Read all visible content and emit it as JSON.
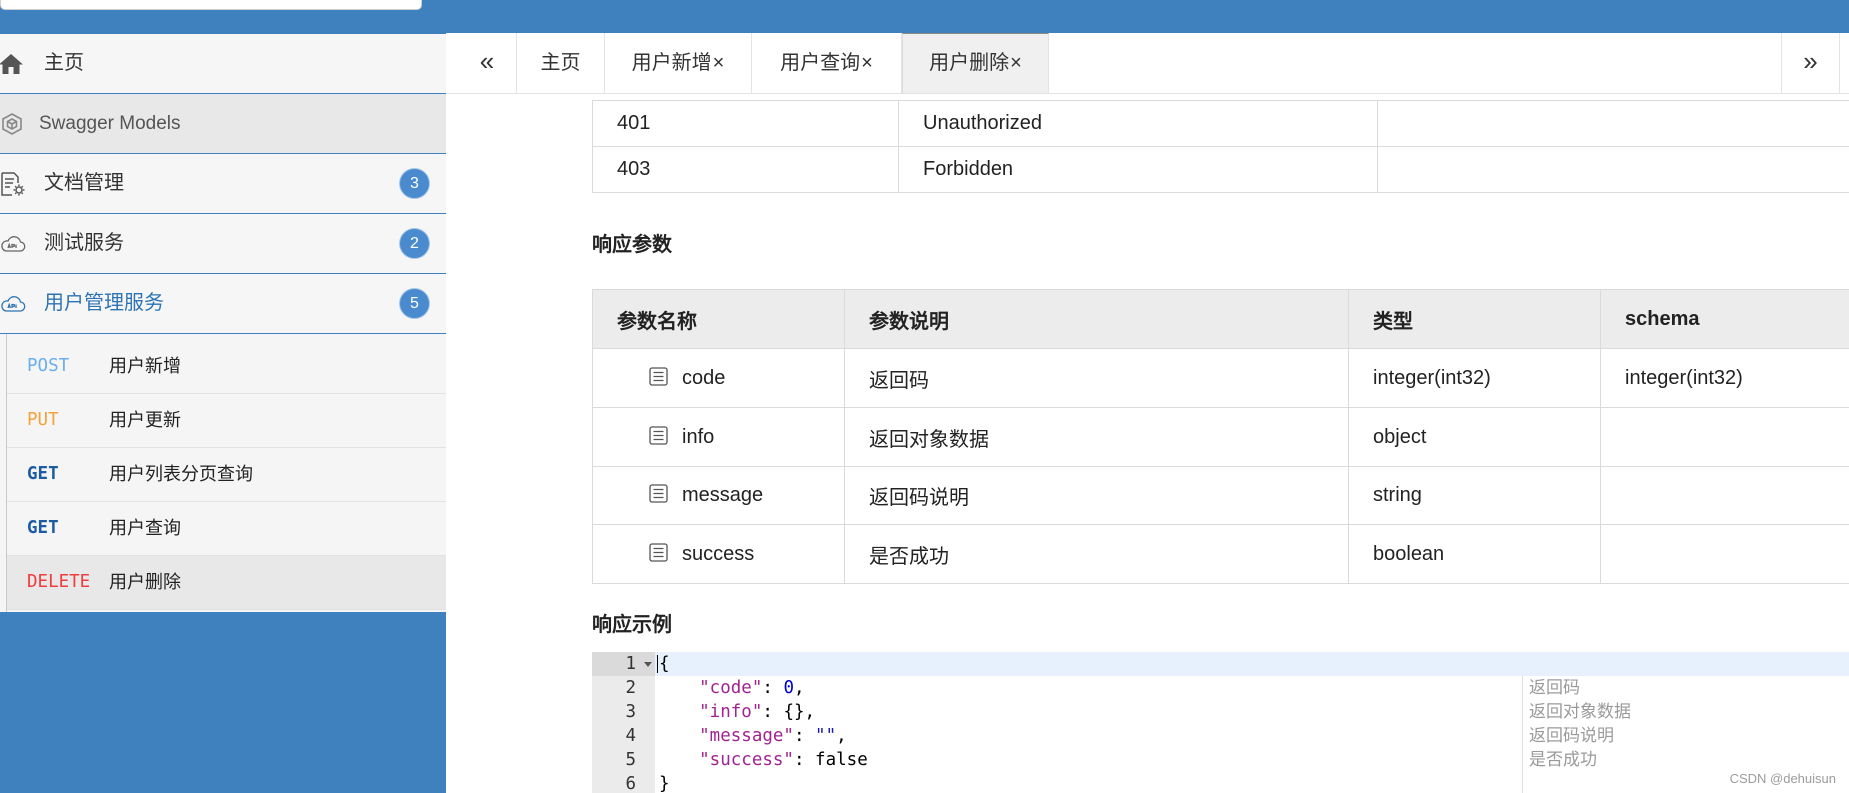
{
  "colors": {
    "brand_blue": "#3f80be",
    "badge_blue": "#4a8bcf",
    "active_nav_text": "#2e74b5",
    "method_post": "#6aaef0",
    "method_put": "#f4a13a",
    "method_get": "#1d5ca3",
    "method_delete": "#f03c3c"
  },
  "sidebar": {
    "items": [
      {
        "label": "主页",
        "icon": "home-icon"
      },
      {
        "label": "Swagger Models",
        "icon": "swagger-models-icon"
      },
      {
        "label": "文档管理",
        "icon": "document-settings-icon",
        "badge": "3"
      },
      {
        "label": "测试服务",
        "icon": "api-cloud-icon",
        "badge": "2"
      },
      {
        "label": "用户管理服务",
        "icon": "api-cloud-icon",
        "badge": "5",
        "active": true
      }
    ],
    "endpoints": [
      {
        "method": "POST",
        "label": "用户新增"
      },
      {
        "method": "PUT",
        "label": "用户更新"
      },
      {
        "method": "GET",
        "label": "用户列表分页查询"
      },
      {
        "method": "GET",
        "label": "用户查询"
      },
      {
        "method": "DELETE",
        "label": "用户删除",
        "selected": true
      }
    ]
  },
  "tabs": {
    "prev_label": "«",
    "next_label": "»",
    "items": [
      {
        "label": "主页"
      },
      {
        "label": "用户新增",
        "close": "×"
      },
      {
        "label": "用户查询",
        "close": "×"
      },
      {
        "label": "用户删除",
        "close": "×",
        "active": true
      }
    ]
  },
  "status_codes": {
    "rows": [
      {
        "code": "401",
        "description": "Unauthorized"
      },
      {
        "code": "403",
        "description": "Forbidden"
      }
    ]
  },
  "response_params": {
    "heading": "响应参数",
    "columns": [
      "参数名称",
      "参数说明",
      "类型",
      "schema"
    ],
    "rows": [
      {
        "name": "code",
        "description": "返回码",
        "type": "integer(int32)",
        "schema": "integer(int32)"
      },
      {
        "name": "info",
        "description": "返回对象数据",
        "type": "object"
      },
      {
        "name": "message",
        "description": "返回码说明",
        "type": "string"
      },
      {
        "name": "success",
        "description": "是否成功",
        "type": "boolean"
      }
    ]
  },
  "response_example": {
    "heading": "响应示例",
    "lines": [
      {
        "no": "1",
        "text": "{"
      },
      {
        "no": "2",
        "key": "\"code\"",
        "sep": ": ",
        "value": "0",
        "tail": ",",
        "comment": "返回码"
      },
      {
        "no": "3",
        "key": "\"info\"",
        "sep": ": ",
        "value": "{}",
        "tail": ",",
        "comment": "返回对象数据"
      },
      {
        "no": "4",
        "key": "\"message\"",
        "sep": ": ",
        "value": "\"\"",
        "tail": ",",
        "comment": "返回码说明"
      },
      {
        "no": "5",
        "key": "\"success\"",
        "sep": ": ",
        "value": "false",
        "comment": "是否成功"
      },
      {
        "no": "6",
        "text": "}"
      }
    ]
  },
  "watermark": "CSDN @dehuisun"
}
